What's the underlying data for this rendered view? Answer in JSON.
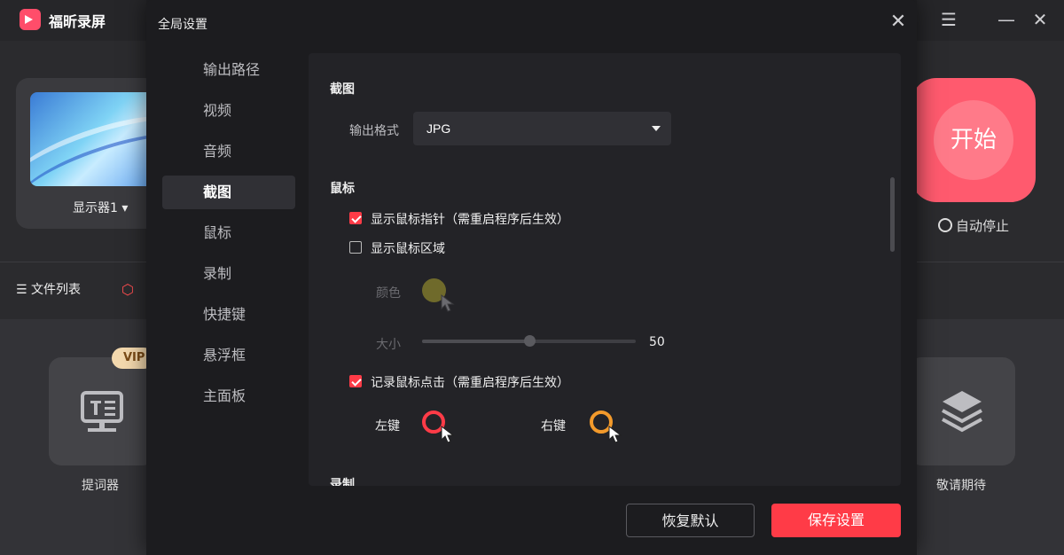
{
  "app": {
    "name": "福昕录屏",
    "display_label": "显示器1 ▾",
    "file_list": "文件列表",
    "start_label": "开始",
    "auto_stop": "自动停止",
    "vip": "VIP",
    "tools": [
      {
        "label": "提词器"
      },
      {
        "label": "敬请期待"
      }
    ],
    "window_controls": {
      "menu": "menu-icon",
      "minimize": "minimize-icon",
      "close": "close-icon"
    }
  },
  "dialog": {
    "title": "全局设置",
    "nav": [
      {
        "label": "输出路径",
        "active": false
      },
      {
        "label": "视频",
        "active": false
      },
      {
        "label": "音频",
        "active": false
      },
      {
        "label": "截图",
        "active": true
      },
      {
        "label": "鼠标",
        "active": false
      },
      {
        "label": "录制",
        "active": false
      },
      {
        "label": "快捷键",
        "active": false
      },
      {
        "label": "悬浮框",
        "active": false
      },
      {
        "label": "主面板",
        "active": false
      }
    ],
    "screenshot": {
      "section_title": "截图",
      "format_label": "输出格式",
      "format_value": "JPG"
    },
    "mouse": {
      "section_title": "鼠标",
      "show_pointer": {
        "label": "显示鼠标指针（需重启程序后生效）",
        "checked": true
      },
      "show_area": {
        "label": "显示鼠标区域",
        "checked": false
      },
      "color_label": "颜色",
      "size_label": "大小",
      "size_value": "50",
      "size_fraction": 0.5,
      "record_clicks": {
        "label": "记录鼠标点击（需重启程序后生效）",
        "checked": true
      },
      "left_label": "左键",
      "right_label": "右键",
      "colors": {
        "area": "#6f6a2b",
        "left_click": "#ff3b47",
        "right_click": "#f39a2b"
      }
    },
    "next_section_title": "录制",
    "buttons": {
      "reset": "恢复默认",
      "save": "保存设置"
    },
    "accent": "#ff3b47"
  }
}
